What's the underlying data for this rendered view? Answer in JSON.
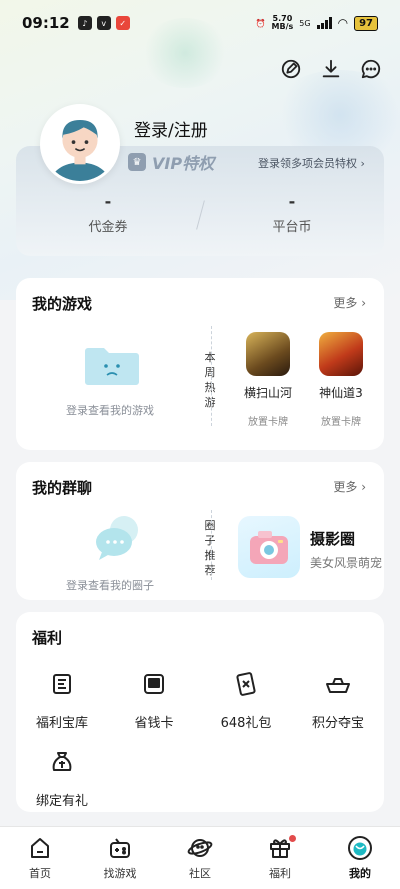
{
  "status_bar": {
    "time": "09:12",
    "speed_value": "5.70",
    "speed_unit": "MB/s",
    "network": "5G",
    "battery": "97"
  },
  "profile": {
    "login_label": "登录/注册"
  },
  "vip": {
    "badge_text": "VIP特权",
    "link_text": "登录领多项会员特权 ›"
  },
  "stats": [
    {
      "value": "-",
      "label": "代金券"
    },
    {
      "value": "-",
      "label": "平台币"
    }
  ],
  "my_games": {
    "title": "我的游戏",
    "more": "更多 ›",
    "empty_text": "登录查看我的游戏",
    "side_label": "本周热游",
    "games": [
      {
        "name": "横扫山河",
        "tag": "放置卡牌"
      },
      {
        "name": "神仙道3",
        "tag": "放置卡牌"
      }
    ]
  },
  "my_groups": {
    "title": "我的群聊",
    "more": "更多 ›",
    "empty_text": "登录查看我的圈子",
    "side_label": "圈子推荐",
    "circle": {
      "name": "摄影圈",
      "desc": "美女风景萌宠"
    }
  },
  "welfare": {
    "title": "福利",
    "items": [
      {
        "label": "福利宝库",
        "icon": "treasury-icon"
      },
      {
        "label": "省钱卡",
        "icon": "savings-card-icon"
      },
      {
        "label": "648礼包",
        "icon": "gift-pack-icon"
      },
      {
        "label": "积分夺宝",
        "icon": "ingot-icon"
      },
      {
        "label": "绑定有礼",
        "icon": "bind-bag-icon"
      }
    ]
  },
  "nav": [
    {
      "label": "首页",
      "icon": "home-icon"
    },
    {
      "label": "找游戏",
      "icon": "gamepad-icon"
    },
    {
      "label": "社区",
      "icon": "community-icon"
    },
    {
      "label": "福利",
      "icon": "gift-icon"
    },
    {
      "label": "我的",
      "icon": "profile-icon"
    }
  ],
  "colors": {
    "accent": "#1db9c3",
    "vip_gray": "#8f9eb0",
    "nav_dot": "#e24b4b"
  }
}
